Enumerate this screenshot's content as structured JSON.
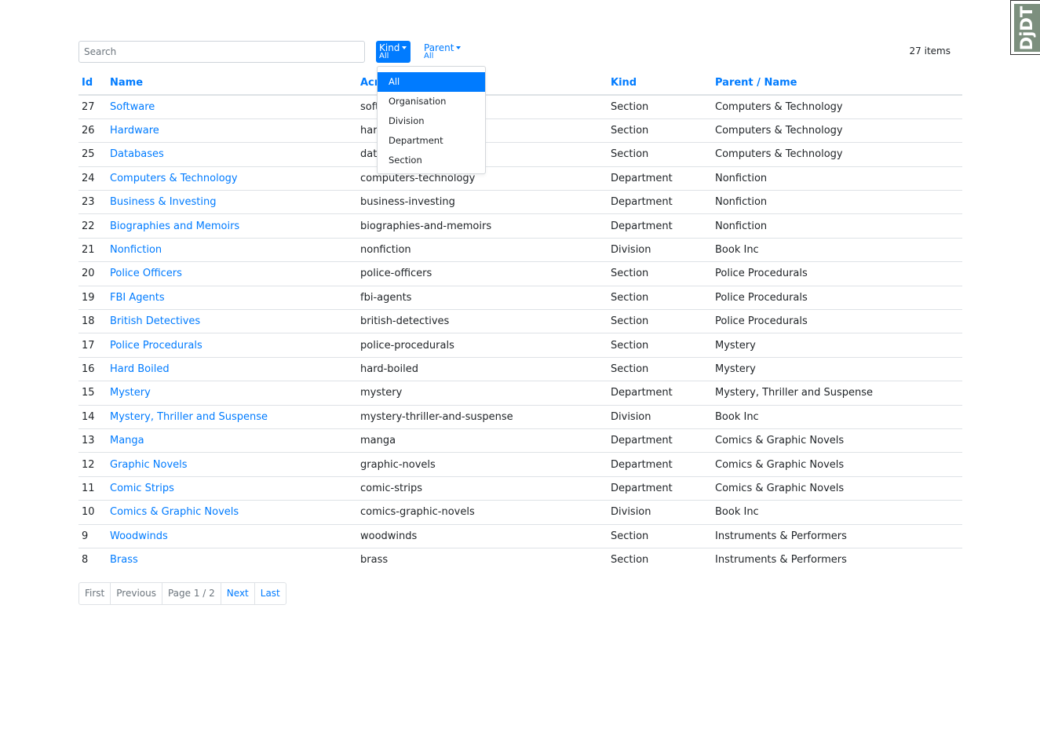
{
  "toolbar": {
    "search_placeholder": "Search",
    "kind_filter": {
      "label": "Kind",
      "value": "All"
    },
    "parent_filter": {
      "label": "Parent",
      "value": "All"
    },
    "item_count": "27 items"
  },
  "kind_dropdown": {
    "options": [
      "All",
      "Organisation",
      "Division",
      "Department",
      "Section"
    ],
    "selected": "All"
  },
  "table": {
    "columns": [
      "Id",
      "Name",
      "Acronym",
      "Kind",
      "Parent / Name"
    ],
    "rows": [
      {
        "id": "27",
        "name": "Software",
        "acronym": "software",
        "kind": "Section",
        "parent": "Computers & Technology"
      },
      {
        "id": "26",
        "name": "Hardware",
        "acronym": "hardware",
        "kind": "Section",
        "parent": "Computers & Technology"
      },
      {
        "id": "25",
        "name": "Databases",
        "acronym": "databases",
        "kind": "Section",
        "parent": "Computers & Technology"
      },
      {
        "id": "24",
        "name": "Computers & Technology",
        "acronym": "computers-technology",
        "kind": "Department",
        "parent": "Nonfiction"
      },
      {
        "id": "23",
        "name": "Business & Investing",
        "acronym": "business-investing",
        "kind": "Department",
        "parent": "Nonfiction"
      },
      {
        "id": "22",
        "name": "Biographies and Memoirs",
        "acronym": "biographies-and-memoirs",
        "kind": "Department",
        "parent": "Nonfiction"
      },
      {
        "id": "21",
        "name": "Nonfiction",
        "acronym": "nonfiction",
        "kind": "Division",
        "parent": "Book Inc"
      },
      {
        "id": "20",
        "name": "Police Officers",
        "acronym": "police-officers",
        "kind": "Section",
        "parent": "Police Procedurals"
      },
      {
        "id": "19",
        "name": "FBI Agents",
        "acronym": "fbi-agents",
        "kind": "Section",
        "parent": "Police Procedurals"
      },
      {
        "id": "18",
        "name": "British Detectives",
        "acronym": "british-detectives",
        "kind": "Section",
        "parent": "Police Procedurals"
      },
      {
        "id": "17",
        "name": "Police Procedurals",
        "acronym": "police-procedurals",
        "kind": "Section",
        "parent": "Mystery"
      },
      {
        "id": "16",
        "name": "Hard Boiled",
        "acronym": "hard-boiled",
        "kind": "Section",
        "parent": "Mystery"
      },
      {
        "id": "15",
        "name": "Mystery",
        "acronym": "mystery",
        "kind": "Department",
        "parent": "Mystery, Thriller and Suspense"
      },
      {
        "id": "14",
        "name": "Mystery, Thriller and Suspense",
        "acronym": "mystery-thriller-and-suspense",
        "kind": "Division",
        "parent": "Book Inc"
      },
      {
        "id": "13",
        "name": "Manga",
        "acronym": "manga",
        "kind": "Department",
        "parent": "Comics & Graphic Novels"
      },
      {
        "id": "12",
        "name": "Graphic Novels",
        "acronym": "graphic-novels",
        "kind": "Department",
        "parent": "Comics & Graphic Novels"
      },
      {
        "id": "11",
        "name": "Comic Strips",
        "acronym": "comic-strips",
        "kind": "Department",
        "parent": "Comics & Graphic Novels"
      },
      {
        "id": "10",
        "name": "Comics & Graphic Novels",
        "acronym": "comics-graphic-novels",
        "kind": "Division",
        "parent": "Book Inc"
      },
      {
        "id": "9",
        "name": "Woodwinds",
        "acronym": "woodwinds",
        "kind": "Section",
        "parent": "Instruments & Performers"
      },
      {
        "id": "8",
        "name": "Brass",
        "acronym": "brass",
        "kind": "Section",
        "parent": "Instruments & Performers"
      }
    ]
  },
  "pagination": {
    "first": "First",
    "previous": "Previous",
    "page_info": "Page 1 / 2",
    "next": "Next",
    "last": "Last"
  },
  "debug_toolbar": {
    "label": "DjDT"
  },
  "colors": {
    "primary": "#007bff",
    "debug_toolbar_bg": "#7c8f7e"
  }
}
